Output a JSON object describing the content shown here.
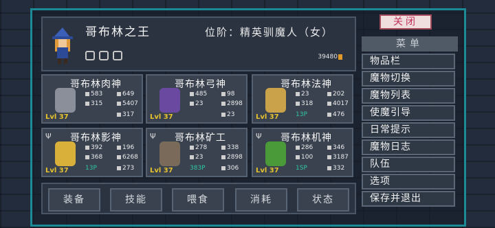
{
  "header": {
    "name": "哥布林之王",
    "rank": "位阶：精英驯魔人（女）",
    "gold": "39480"
  },
  "close_button": "关闭",
  "menu": {
    "title": "菜单",
    "items": [
      "物品栏",
      "魔物切换",
      "魔物列表",
      "使魔引导",
      "日常提示",
      "魔物日志",
      "队伍",
      "选项",
      "保存并退出"
    ]
  },
  "monsters": [
    {
      "name": "哥布林肉神",
      "level": "Lvl 37",
      "atk": "583",
      "def": "649",
      "hp": "315",
      "mp": "5407",
      "sp": "",
      "stamina": "317",
      "color": "#8a8f9a"
    },
    {
      "name": "哥布林弓神",
      "level": "Lvl 37",
      "atk": "485",
      "def": "98",
      "hp": "23",
      "mp": "2898",
      "sp": "",
      "stamina": "23",
      "color": "#6a4aa0"
    },
    {
      "name": "哥布林法神",
      "level": "Lvl 37",
      "atk": "23",
      "def": "202",
      "hp": "318",
      "mp": "4017",
      "sp": "13P",
      "stamina": "476",
      "color": "#c9a24a"
    },
    {
      "name": "哥布林影神",
      "level": "Lvl 37",
      "atk": "392",
      "def": "196",
      "hp": "368",
      "mp": "6268",
      "sp": "13P",
      "stamina": "273",
      "color": "#d8b03a"
    },
    {
      "name": "哥布林矿工",
      "level": "Lvl 37",
      "atk": "278",
      "def": "338",
      "hp": "23",
      "mp": "2898",
      "sp": "383P",
      "stamina": "306",
      "color": "#7a6a5a"
    },
    {
      "name": "哥布林机神",
      "level": "Lvl 37",
      "atk": "286",
      "def": "346",
      "hp": "100",
      "mp": "3187",
      "sp": "1SP",
      "stamina": "332",
      "color": "#4a9a3a"
    }
  ],
  "tabs": [
    "装备",
    "技能",
    "喂食",
    "消耗",
    "状态"
  ]
}
